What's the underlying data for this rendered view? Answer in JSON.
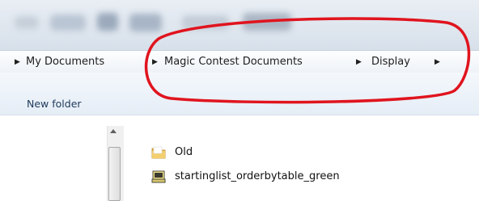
{
  "breadcrumb": {
    "items": [
      {
        "label": "My Documents"
      },
      {
        "label": "Magic Contest Documents"
      },
      {
        "label": "Display"
      }
    ]
  },
  "commands": {
    "new_folder_label": "New folder"
  },
  "files": [
    {
      "name": "Old",
      "icon": "folder-icon"
    },
    {
      "name": "startinglist_orderbytable_green",
      "icon": "display-file-icon"
    }
  ],
  "colors": {
    "annotation": "#e0141e",
    "folder": "#e8b548",
    "command_text": "#1e395b"
  }
}
